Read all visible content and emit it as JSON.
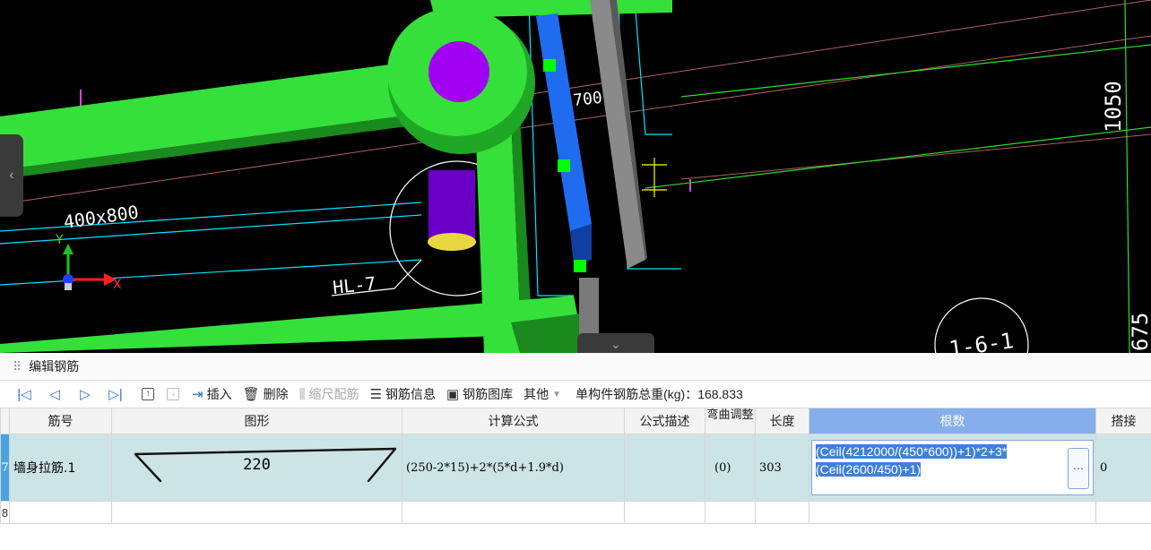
{
  "viewport": {
    "labels": {
      "section": "400x800",
      "beam": "HL-7",
      "dim_700": "700",
      "dim_1050": "1050",
      "detail": "1-6-1",
      "edge": "675"
    },
    "axis": {
      "x": "X",
      "y": "Y"
    },
    "colors": {
      "bg": "#000000",
      "member": "#35e03a",
      "column": "#a100f2",
      "rebar": "#1f6cf0",
      "line": "#00e5ff"
    },
    "icons": {
      "left_tab": "chevron-left-icon",
      "bottom_tab": "chevron-down-icon"
    }
  },
  "panel": {
    "title": "编辑钢筋",
    "toolbar": {
      "first_icon": "first-record-icon",
      "prev_icon": "prev-record-icon",
      "next_icon": "next-record-icon",
      "last_icon": "last-record-icon",
      "insert": "插入",
      "delete": "删除",
      "scale": "缩尺配筋",
      "info": "钢筋信息",
      "library": "钢筋图库",
      "other": "其他",
      "total_label": "单构件钢筋总重(kg)：168.833"
    },
    "columns": [
      "筋号",
      "图形",
      "计算公式",
      "公式描述",
      "弯曲调整",
      "长度",
      "根数",
      "搭接"
    ],
    "rows": [
      {
        "index": "7",
        "name": "墙身拉筋.1",
        "shape_value": "220",
        "formula": "(250-2*15)+2*(5*d+1.9*d)",
        "description": "",
        "bend": "(0)",
        "length": "303",
        "count": "(Ceil(4212000/(450*600))+1)*2+3*(Ceil(2600/450)+1)",
        "lap": "0"
      },
      {
        "index": "8"
      }
    ],
    "ellipsis": "..."
  }
}
